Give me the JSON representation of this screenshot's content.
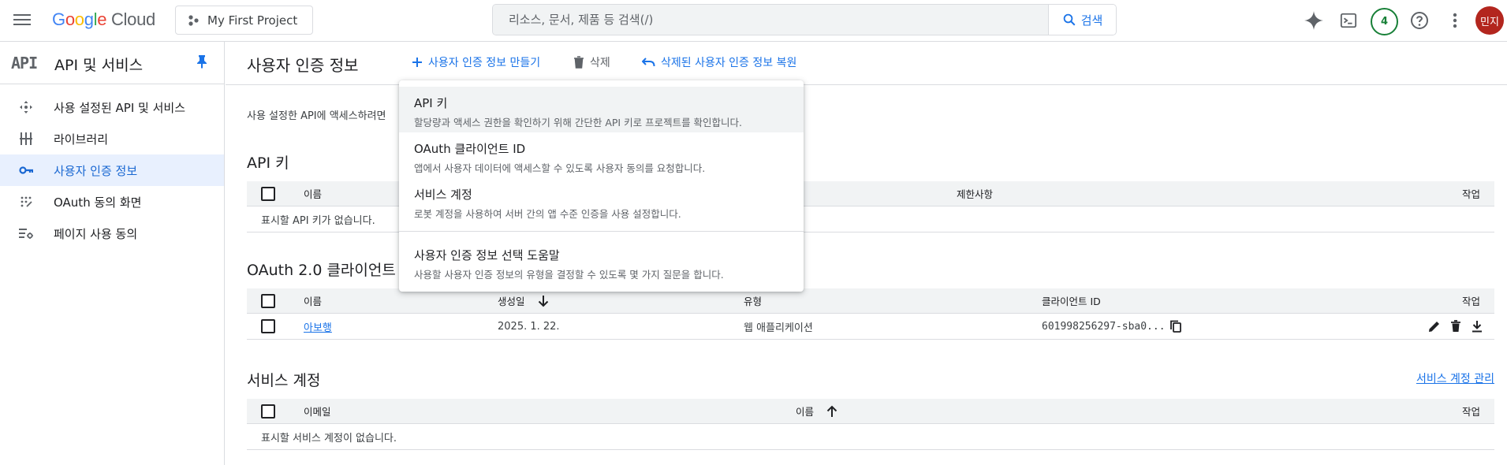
{
  "topbar": {
    "logo_google": "Google",
    "logo_cloud": "Cloud",
    "project_name": "My First Project",
    "search_placeholder": "리소스, 문서, 제품 등 검색(/)",
    "search_button": "검색",
    "notifications_count": "4",
    "avatar_initials": "민지",
    "icons": [
      "menu-icon",
      "project-icon",
      "search-icon",
      "gemini-icon",
      "cloud-shell-icon",
      "help-icon",
      "more-vert-icon"
    ]
  },
  "sidebar": {
    "logo_text": "API",
    "title": "API 및 서비스",
    "items": [
      {
        "label": "사용 설정된 API 및 서비스",
        "icon": "enabled-apis-icon",
        "active": false
      },
      {
        "label": "라이브러리",
        "icon": "library-icon",
        "active": false
      },
      {
        "label": "사용자 인증 정보",
        "icon": "key-icon",
        "active": true
      },
      {
        "label": "OAuth 동의 화면",
        "icon": "oauth-icon",
        "active": false
      },
      {
        "label": "페이지 사용 동의",
        "icon": "page-usage-icon",
        "active": false
      }
    ]
  },
  "main": {
    "page_title": "사용자 인증 정보",
    "actions": {
      "create": "사용자 인증 정보 만들기",
      "delete": "삭제",
      "restore": "삭제된 사용자 인증 정보 복원"
    },
    "intro_text": "사용 설정한 API에 액세스하려면",
    "api_keys": {
      "title": "API 키",
      "columns": [
        "이름",
        "제한사항",
        "작업"
      ],
      "empty": "표시할 API 키가 없습니다."
    },
    "oauth_clients": {
      "title": "OAuth 2.0 클라이언트",
      "columns": [
        "이름",
        "생성일",
        "유형",
        "클라이언트 ID",
        "작업"
      ],
      "rows": [
        {
          "name": "아보행",
          "created": "2025. 1. 22.",
          "type": "웹 애플리케이션",
          "client_id": "601998256297-sba0..."
        }
      ]
    },
    "service_accounts": {
      "title": "서비스 계정",
      "manage_link": "서비스 계정 관리",
      "columns": [
        "이메일",
        "이름",
        "작업"
      ],
      "empty": "표시할 서비스 계정이 없습니다."
    }
  },
  "dropdown": {
    "items": [
      {
        "title": "API 키",
        "desc": "할당량과 액세스 권한을 확인하기 위해 간단한 API 키로 프로젝트를 확인합니다."
      },
      {
        "title": "OAuth 클라이언트 ID",
        "desc": "앱에서 사용자 데이터에 액세스할 수 있도록 사용자 동의를 요청합니다."
      },
      {
        "title": "서비스 계정",
        "desc": "로봇 계정을 사용하여 서버 간의 앱 수준 인증을 사용 설정합니다."
      },
      {
        "title": "사용자 인증 정보 선택 도움말",
        "desc": "사용할 사용자 인증 정보의 유형을 결정할 수 있도록 몇 가지 질문을 합니다."
      }
    ]
  },
  "colors": {
    "accent": "#1a73e8",
    "active_bg": "#e8f0fe",
    "avatar": "#b3261e",
    "badge": "#188038"
  }
}
